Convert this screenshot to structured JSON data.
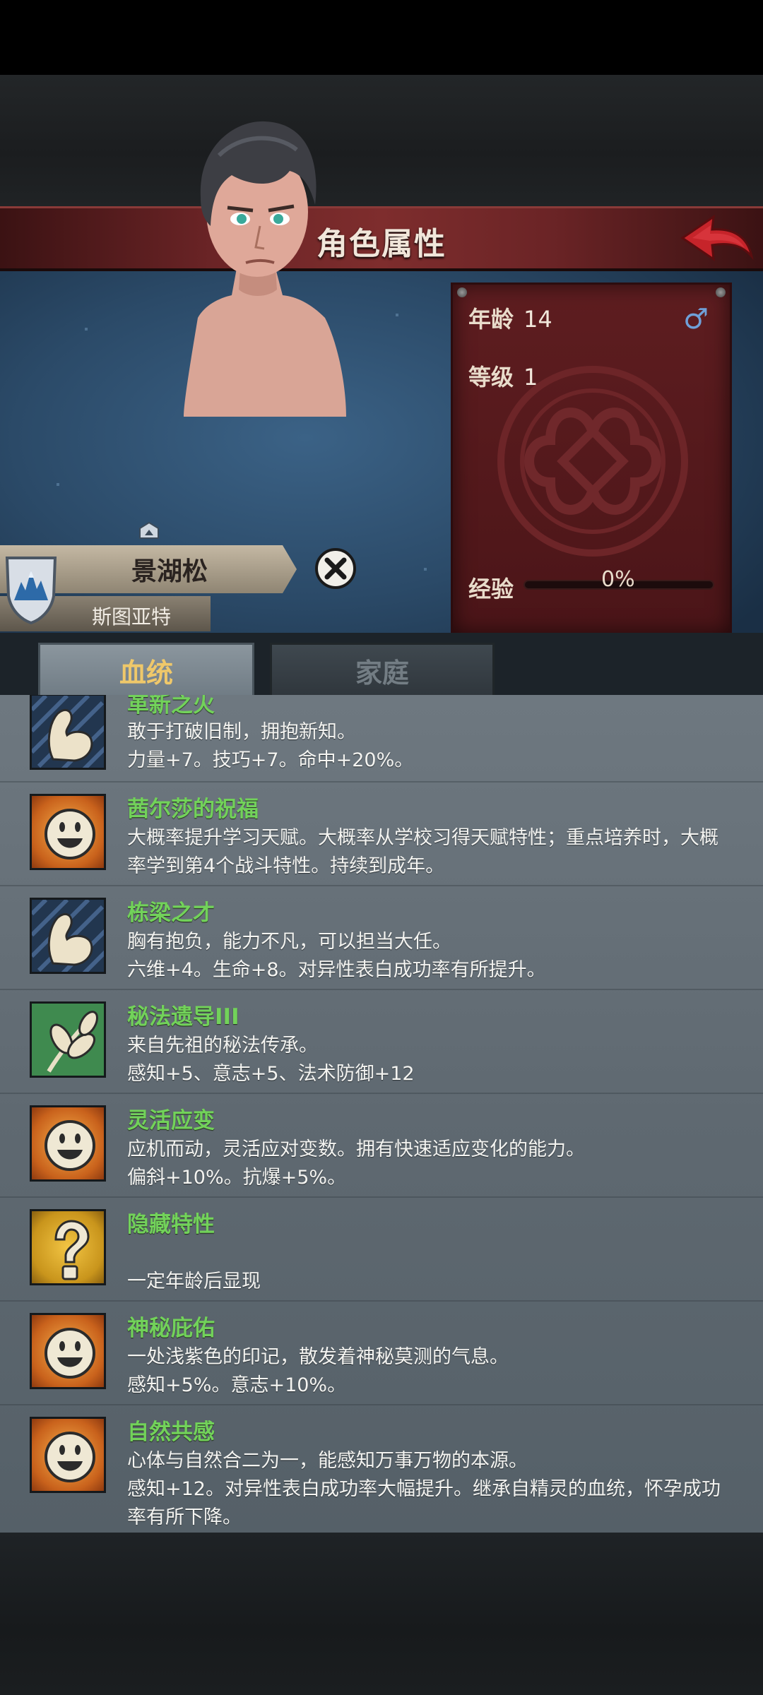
{
  "header": {
    "title": "角色属性"
  },
  "character": {
    "name": "景湖松",
    "origin": "斯图亚特",
    "age_label": "年龄",
    "age": "14",
    "gender_symbol": "♂",
    "level_label": "等级",
    "level": "1",
    "exp_label": "经验",
    "exp": "0%"
  },
  "tabs": [
    {
      "label": "血统"
    },
    {
      "label": "家庭"
    }
  ],
  "traits": [
    {
      "icon": "muscle-arm-icon",
      "name": "革新之火",
      "lines": [
        "敢于打破旧制，拥抱新知。",
        "力量+7。技巧+7。命中+20%。"
      ]
    },
    {
      "icon": "sun-smiley-icon",
      "name": "茜尔莎的祝福",
      "lines": [
        "大概率提升学习天赋。大概率从学校习得天赋特性；重点培养时，大概",
        "率学到第4个战斗特性。持续到成年。"
      ]
    },
    {
      "icon": "muscle-arm-icon",
      "name": "栋梁之才",
      "lines": [
        "胸有抱负，能力不凡，可以担当大任。",
        "六维+4。生命+8。对异性表白成功率有所提升。"
      ]
    },
    {
      "icon": "herb-leaf-icon",
      "name": "秘法遗导III",
      "lines": [
        "来自先祖的秘法传承。",
        "感知+5、意志+5、法术防御+12"
      ]
    },
    {
      "icon": "sun-smiley-icon",
      "name": "灵活应变",
      "lines": [
        "应机而动，灵活应对变数。拥有快速适应变化的能力。",
        "偏斜+10%。抗爆+5%。"
      ]
    },
    {
      "icon": "question-mark-icon",
      "name": "隐藏特性",
      "lines": [
        "",
        "一定年龄后显现"
      ]
    },
    {
      "icon": "sun-smiley-icon",
      "name": "神秘庇佑",
      "lines": [
        "一处浅紫色的印记，散发着神秘莫测的气息。",
        "感知+5%。意志+10%。"
      ]
    },
    {
      "icon": "sun-smiley-icon",
      "name": "自然共感",
      "lines": [
        "心体与自然合二为一，能感知万事万物的本源。",
        "感知+12。对异性表白成功率大幅提升。继承自精灵的血统，怀孕成功",
        "率有所下降。"
      ]
    }
  ],
  "colors": {
    "trait_name": "#72d25a",
    "title_bar": "#7e2d2d",
    "tab_active_text": "#efc86a"
  }
}
